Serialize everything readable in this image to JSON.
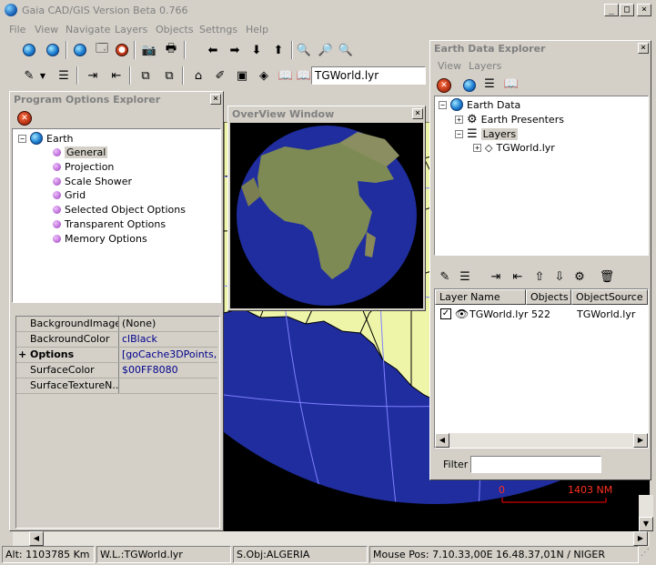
{
  "window": {
    "title": "Gaia CAD/GIS Version Beta 0.766",
    "minimize": "_",
    "maximize": "□",
    "close": "×"
  },
  "menu": [
    "File",
    "View",
    "Navigate",
    "Layers",
    "Objects",
    "Settngs",
    "Help"
  ],
  "toolbar": {
    "layer_combo_value": "TGWorld.lyr"
  },
  "program_options": {
    "title": "Program Options Explorer",
    "root": "Earth",
    "items": [
      "General",
      "Projection",
      "Scale Shower",
      "Grid",
      "Selected Object Options",
      "Transparent Options",
      "Memory Options"
    ],
    "properties": [
      {
        "key": "BackgroundImage",
        "value": "(None)"
      },
      {
        "key": "BackroundColor",
        "value": "clBlack"
      },
      {
        "key": "Options",
        "value": "[goCache3DPoints,...",
        "expand": "+"
      },
      {
        "key": "SurfaceColor",
        "value": "$00FF8080"
      },
      {
        "key": "SurfaceTextureN...",
        "value": ""
      }
    ]
  },
  "overview": {
    "title": "OverView Window"
  },
  "earth_explorer": {
    "title": "Earth Data Explorer",
    "menu": [
      "View",
      "Layers"
    ],
    "tree": {
      "root": "Earth Data",
      "presenters": "Earth Presenters",
      "layers": "Layers",
      "layer_item": "TGWorld.lyr"
    },
    "columns": [
      "Layer Name",
      "Objects",
      "ObjectSource"
    ],
    "rows": [
      {
        "name": "TGWorld.lyr",
        "objects": "522",
        "source": "TGWorld.lyr"
      }
    ],
    "filter_label": "Filter",
    "filter_value": ""
  },
  "scale_bar": {
    "start": "0",
    "end": "1403 NM"
  },
  "status": {
    "alt": "Alt: 1103785 Km",
    "working_layer": "W.L.:TGWorld.lyr",
    "selected_object": "S.Obj:ALGERIA",
    "mouse_pos": "Mouse Pos: 7.10.33,00E 16.48.37,01N / NIGER"
  },
  "colors": {
    "ocean": "#1f2d9e",
    "land": "#eef5a8",
    "grid": "#8080ff",
    "scale": "#ff0000"
  }
}
